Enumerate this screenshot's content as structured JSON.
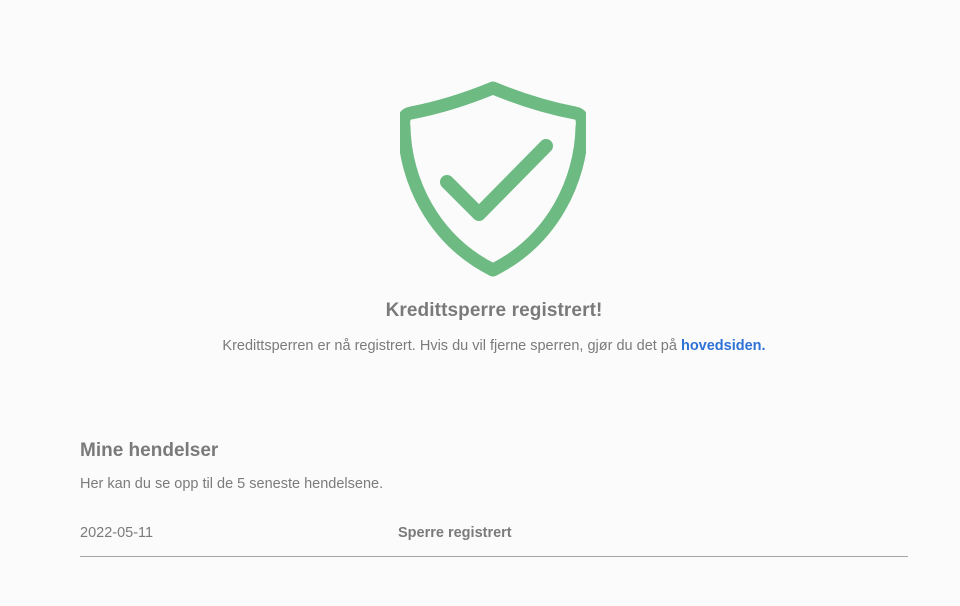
{
  "confirmation": {
    "icon": "shield-check-icon",
    "icon_color": "#6dbb83",
    "title": "Kredittsperre registrert!",
    "text_before_link": "Kredittsperren er nå registrert. Hvis du vil fjerne sperren, gjør du det på ",
    "link_label": "hovedsiden.",
    "link_color": "#2f72d6"
  },
  "events": {
    "title": "Mine hendelser",
    "subtitle": "Her kan du se opp til de 5 seneste hendelsene.",
    "rows": [
      {
        "date": "2022-05-11",
        "description": "Sperre registrert"
      }
    ]
  }
}
